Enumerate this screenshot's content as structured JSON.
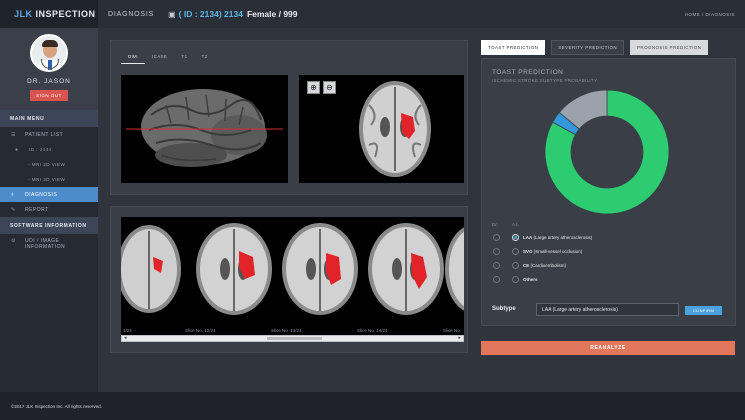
{
  "brand": {
    "prefix": "JLK",
    "name": "INSPECTION"
  },
  "profile": {
    "name": "DR. JASON",
    "signout_label": "SIGN OUT"
  },
  "menu": {
    "main_header": "MAIN MENU",
    "patient_list": "PATIENT LIST",
    "patient_sub": "ID : 2134",
    "mri_2d": "- MRI 2D VIEW",
    "mri_3d": "- MRI 3D VIEW",
    "diagnosis": "DIAGNOSIS",
    "report": "REPORT",
    "software_header": "SOFTWARE INFORMATION",
    "software_item_line1": "UDI / IMAGE",
    "software_item_line2": "INFORMATION"
  },
  "topbar": {
    "title": "DIAGNOSIS",
    "patient_id": "( ID : 2134) 2134",
    "patient_info": "Female / 999",
    "breadcrumb": "HOME  /  DIAGNOSIS"
  },
  "view_tabs": [
    {
      "label": "DWI",
      "active": true
    },
    {
      "label": "ICASE",
      "active": false
    },
    {
      "label": "T1",
      "active": false
    },
    {
      "label": "T2",
      "active": false
    }
  ],
  "zoom": {
    "in_icon": "zoom-in-icon",
    "out_icon": "zoom-out-icon"
  },
  "slices": [
    {
      "label": "1/24"
    },
    {
      "label": "Slice No. 12/24"
    },
    {
      "label": "Slice No. 13/24"
    },
    {
      "label": "Slice No. 14/24"
    },
    {
      "label": "Slice No."
    }
  ],
  "right_tabs": [
    {
      "label": "TOAST PREDICTION",
      "state": "active"
    },
    {
      "label": "SEVERITY PREDICTION",
      "state": "normal"
    },
    {
      "label": "PROGNOSIS PREDICTION",
      "state": "light"
    }
  ],
  "prediction": {
    "title": "TOAST PREDICTION",
    "subtitle": "ISCHEMIC STROKE SUBTYPE PROBABILITY",
    "col_dr": "Dr.",
    "col_ai": "A.I.",
    "options": [
      {
        "abbr": "LAA",
        "full": "(Large artery atherosclerosis)",
        "ai_selected": true
      },
      {
        "abbr": "SVO",
        "full": "(Small-vessel occlusion)",
        "ai_selected": false
      },
      {
        "abbr": "CE",
        "full": "(Cardioembolism)",
        "ai_selected": false
      },
      {
        "abbr": "Others",
        "full": "",
        "ai_selected": false
      }
    ],
    "subtype_label": "Subtype",
    "subtype_value": "LAA (Large artery atherosclerosis)",
    "confirm_label": "CONFIRM",
    "reanalyze_label": "REANALYZE"
  },
  "chart_data": {
    "type": "pie",
    "categories": [
      "LAA",
      "SVO",
      "CE",
      "Others"
    ],
    "values": [
      0.83,
      0.03,
      0.0,
      0.14
    ],
    "colors": [
      "#2ecc71",
      "#3498db",
      "#5b6170",
      "#9aa3ab"
    ],
    "donut": true
  },
  "footer": {
    "text": "©2017 JLK Inspection Inc. All rights reserved."
  }
}
